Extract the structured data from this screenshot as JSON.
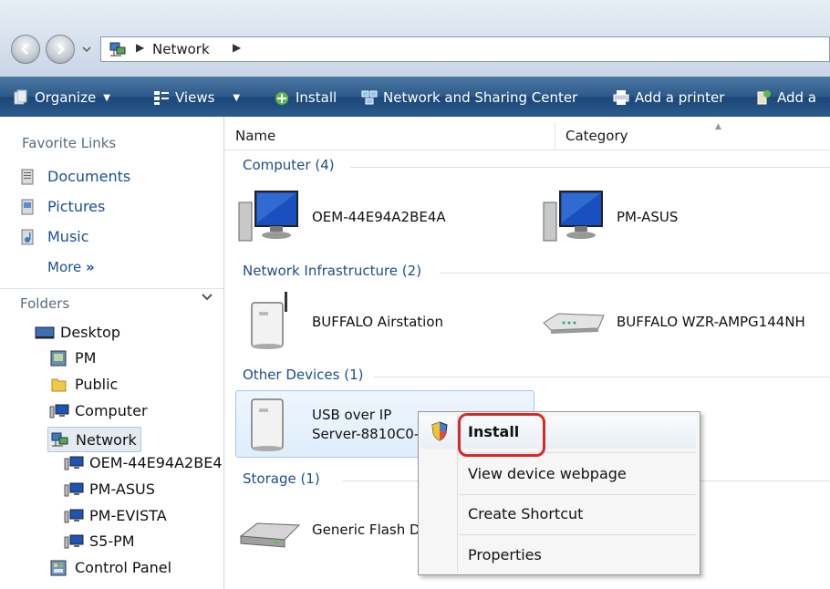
{
  "address": {
    "location": "Network"
  },
  "toolbar": {
    "organize": "Organize",
    "views": "Views",
    "install": "Install",
    "network_sharing": "Network and Sharing Center",
    "add_printer": "Add a printer",
    "add_truncated": "Add a"
  },
  "nav": {
    "favorite_links_label": "Favorite Links",
    "links": [
      "Documents",
      "Pictures",
      "Music"
    ],
    "more": "More",
    "folders_label": "Folders",
    "tree": [
      "Desktop",
      "PM",
      "Public",
      "Computer",
      "Network",
      "OEM-44E94A2BE4",
      "PM-ASUS",
      "PM-EVISTA",
      "S5-PM",
      "Control Panel"
    ]
  },
  "columns": {
    "name": "Name",
    "category": "Category"
  },
  "groups": {
    "computer": "Computer (4)",
    "infrastructure": "Network Infrastructure (2)",
    "other": "Other Devices (1)",
    "storage": "Storage (1)"
  },
  "devices": {
    "pc1": "OEM-44E94A2BE4A",
    "pc2": "PM-ASUS",
    "router1": "BUFFALO Airstation",
    "router2": "BUFFALO WZR-AMPG144NH",
    "usb_line1": "USB over IP",
    "usb_line2": "Server-8810C0-",
    "flash": "Generic Flash D"
  },
  "context_menu": {
    "install": "Install",
    "view_webpage": "View device webpage",
    "create_shortcut": "Create Shortcut",
    "properties": "Properties"
  }
}
